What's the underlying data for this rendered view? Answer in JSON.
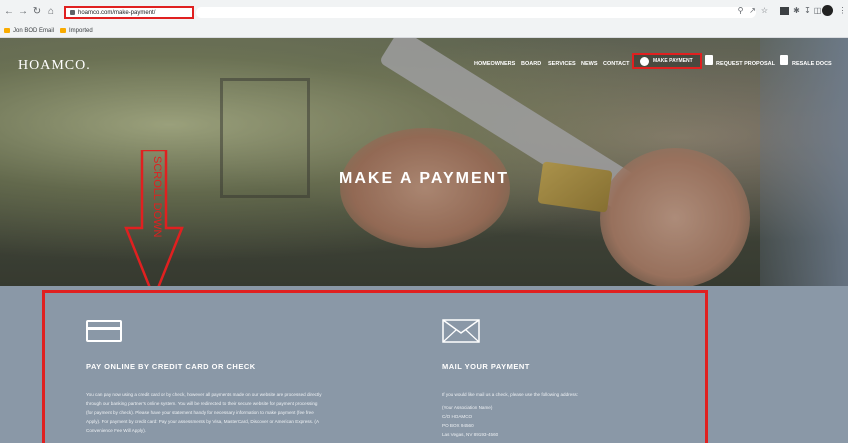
{
  "browser": {
    "url": "hoamco.com/make-payment/",
    "bookmarks": [
      "Jon BOD Email",
      "Imported"
    ],
    "nav_icons": [
      "back-icon",
      "forward-icon",
      "reload-icon",
      "home-icon"
    ],
    "tool_icons": [
      "zoom-icon",
      "share-icon",
      "star-icon",
      "extension-icon",
      "puzzle-icon",
      "download-icon",
      "sidepanel-icon",
      "profile-icon",
      "menu-icon"
    ]
  },
  "site": {
    "logo": "HOAMCO.",
    "nav": [
      "HOMEOWNERS",
      "BOARD",
      "SERVICES",
      "NEWS",
      "CONTACT"
    ],
    "make_payment": "MAKE PAYMENT",
    "request_proposal": "REQUEST PROPOSAL",
    "resale_docs": "RESALE DOCS",
    "hero_title": "MAKE A PAYMENT",
    "annotation": "SCROLL DOWN"
  },
  "sections": {
    "online": {
      "title": "PAY ONLINE BY CREDIT CARD OR CHECK",
      "lines": [
        "You can pay now using a credit card or by check, however all payments made on our website are processed directly",
        "through our banking partner's online system. You will be redirected to their secure website for payment processing",
        "(for payment by check). Please have your statement handy for necessary information to make payment (fee free",
        "Apply). For payment by credit card: Pay your assessments by Visa, MasterCard, Discover or American Express. (A",
        "Convenience Fee Will Apply)."
      ]
    },
    "mail": {
      "title": "MAIL YOUR PAYMENT",
      "intro": "If you would like mail us a check, please use the following address:",
      "address": [
        "(Your Association Name)",
        "C/O HOAMCO",
        "PO BOX 94560",
        "Las Vegas, NV 89193-4560"
      ]
    }
  },
  "colors": {
    "annotation_red": "#e02020",
    "content_bg": "#8a98a7"
  }
}
